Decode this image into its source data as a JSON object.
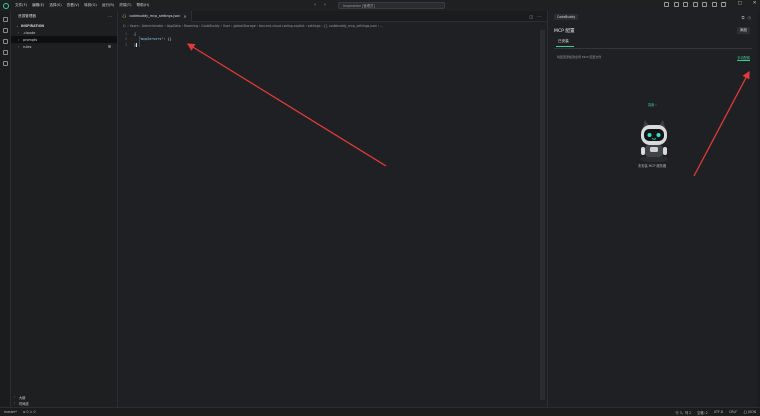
{
  "menu": [
    "文件(F)",
    "编辑(E)",
    "选择(S)",
    "查看(V)",
    "转到(G)",
    "运行(R)",
    "终端(T)",
    "帮助(H)"
  ],
  "search": {
    "placeholder": "Inspiration [管理员]"
  },
  "window_controls": {
    "minimize": "—",
    "maximize": "□",
    "close": "✕"
  },
  "sidebar": {
    "title": "资源管理器",
    "more": "···",
    "root": "INSPIRATION",
    "items": [
      {
        "label": ".claude",
        "selected": false
      },
      {
        "label": "prompts",
        "selected": true
      },
      {
        "label": "rules",
        "selected": false
      }
    ],
    "footer": [
      "大纲",
      "时间线"
    ]
  },
  "editor": {
    "tab": {
      "label": "codebuddy_mcp_settings.json",
      "icon": "{}",
      "close": "✕"
    },
    "breadcrumb": "C: › Users › Administrator › AppData › Roaming › CodeBuddy › User › globalStorage › tencent-cloud.coding-copilot › settings › {} codebuddy_mcp_settings.json › ...",
    "lines": [
      {
        "number": "1",
        "open": "{"
      },
      {
        "number": "2",
        "key": "\"mcpServers\"",
        "rest": ": {}"
      },
      {
        "number": "3",
        "close": "}"
      }
    ]
  },
  "panel": {
    "tab_label": "CodeBuddy",
    "title": "MCP 配置",
    "add_button": "添加",
    "subtab": "已安装",
    "info_text": "将配置添加到全局 MCP 配置文件",
    "config_link": "手动配置",
    "empty_link": "探索 ›",
    "empty_text": "未安装 MCP 服务器"
  },
  "status": {
    "left": [
      "master*",
      "⊗ 0 ⚠ 0"
    ],
    "right": [
      "行 3，列 2",
      "空格: 2",
      "UTF-8",
      "CRLF",
      "{} JSON"
    ]
  },
  "colors": {
    "accent": "#3ecf8e",
    "annotation_arrow": "#e03a3a"
  }
}
